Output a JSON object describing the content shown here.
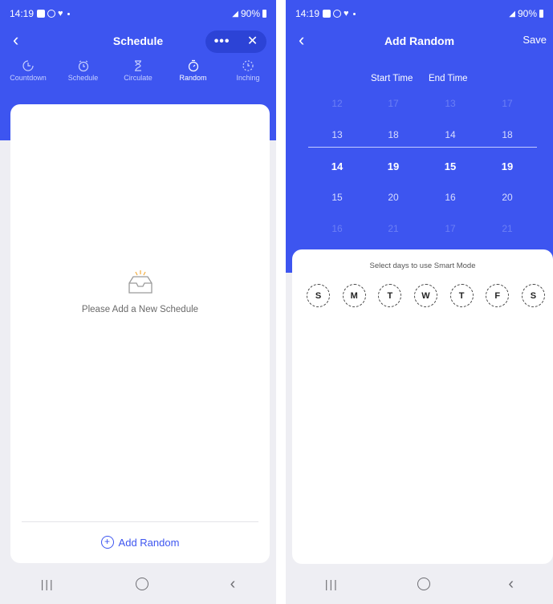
{
  "left_screen": {
    "status": {
      "time": "14:19",
      "battery": "90%"
    },
    "title": "Schedule",
    "more_label": "•••",
    "close_label": "✕",
    "back_label": "‹",
    "tabs": [
      {
        "label": "Countdown",
        "icon": "countdown-icon"
      },
      {
        "label": "Schedule",
        "icon": "alarm-clock-icon"
      },
      {
        "label": "Circulate",
        "icon": "hourglass-icon"
      },
      {
        "label": "Random",
        "icon": "stopwatch-icon"
      },
      {
        "label": "Inching",
        "icon": "inching-icon"
      }
    ],
    "active_tab": "Random",
    "empty_message": "Please Add a New Schedule",
    "add_button": "Add Random",
    "add_icon": "+"
  },
  "right_screen": {
    "status": {
      "time": "14:19",
      "battery": "90%"
    },
    "title": "Add Random",
    "back_label": "‹",
    "save_label": "Save",
    "start_time_label": "Start Time",
    "end_time_label": "End Time",
    "wheel_columns": [
      [
        "12",
        "13",
        "14",
        "15",
        "16"
      ],
      [
        "17",
        "18",
        "19",
        "20",
        "21"
      ],
      [
        "13",
        "14",
        "15",
        "16",
        "17"
      ],
      [
        "17",
        "18",
        "19",
        "20",
        "21"
      ]
    ],
    "selected": [
      "14",
      "19",
      "15",
      "19"
    ],
    "days_title": "Select days to use Smart Mode",
    "days": [
      "S",
      "M",
      "T",
      "W",
      "T",
      "F",
      "S"
    ]
  },
  "nav": {
    "recents": "|||",
    "back": "‹"
  },
  "colors": {
    "primary": "#3d55f0",
    "pill": "#2c43d6",
    "background": "#eeeef3"
  }
}
